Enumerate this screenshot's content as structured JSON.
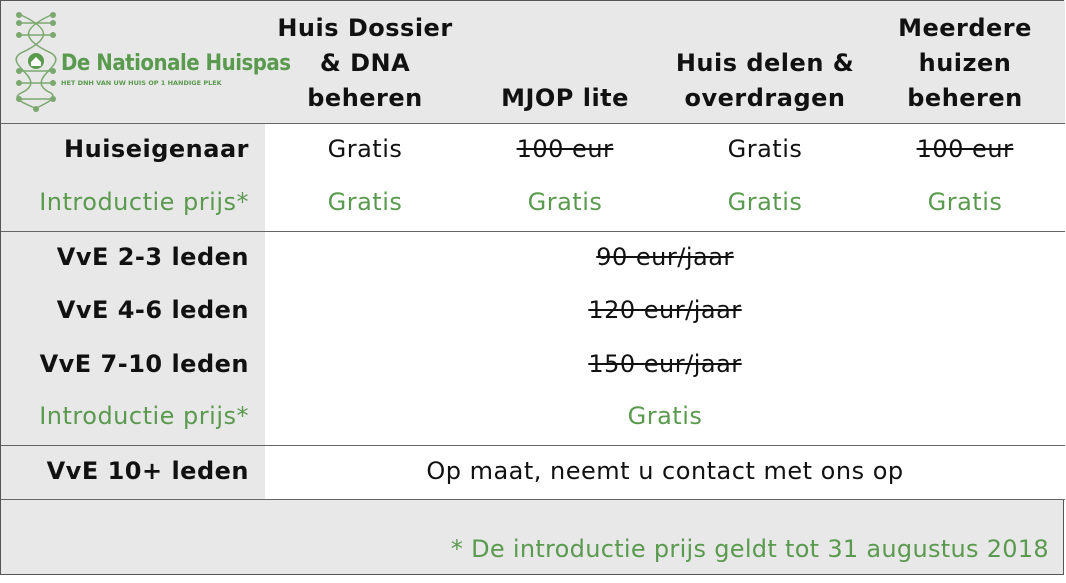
{
  "logo": {
    "title": "De Nationale Huispas",
    "tagline": "HET DNH VAN UW HUIS OP 1 HANDIGE PLEK",
    "emblem": "dna-helix-house-icon",
    "color": "#5a9a4e"
  },
  "columns": [
    "Huis Dossier & DNA beheren",
    "MJOP lite",
    "Huis delen & overdragen",
    "Meerdere huizen beheren"
  ],
  "owner": {
    "label": "Huiseigenaar",
    "values": [
      "Gratis",
      "100 eur",
      "Gratis",
      "100 eur"
    ],
    "intro_label": "Introductie prijs*",
    "intro_values": [
      "Gratis",
      "Gratis",
      "Gratis",
      "Gratis"
    ]
  },
  "vve": {
    "rows": [
      {
        "label": "VvE 2-3 leden",
        "value": "90 eur/jaar"
      },
      {
        "label": "VvE 4-6 leden",
        "value": "120 eur/jaar"
      },
      {
        "label": "VvE 7-10 leden",
        "value": "150 eur/jaar"
      }
    ],
    "intro_label": "Introductie prijs*",
    "intro_value": "Gratis"
  },
  "vve_large": {
    "label": "VvE 10+ leden",
    "value": "Op maat, neemt u contact met ons op"
  },
  "footnote": "* De introductie prijs geldt tot 31 augustus 2018",
  "colors": {
    "accent_green": "#5a9a4e",
    "label_bg": "#e8e8e8",
    "cell_bg": "#ffffff"
  }
}
